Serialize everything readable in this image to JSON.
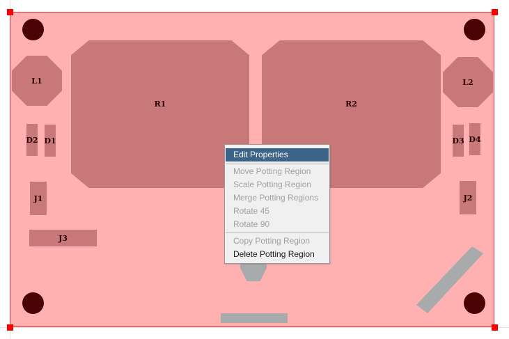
{
  "components": {
    "l1": "L1",
    "l2": "L2",
    "r1": "R1",
    "r2": "R2",
    "d1": "D1",
    "d2": "D2",
    "d3": "D3",
    "d4": "D4",
    "j1": "J1",
    "j2": "J2",
    "j3": "J3"
  },
  "context_menu": {
    "items": [
      {
        "label": "Edit Properties",
        "state": "highlighted"
      },
      {
        "label": "Move Potting Region",
        "state": "disabled"
      },
      {
        "label": "Scale Potting Region",
        "state": "disabled"
      },
      {
        "label": "Merge Potting Regions",
        "state": "disabled"
      },
      {
        "label": "Rotate 45",
        "state": "disabled"
      },
      {
        "label": "Rotate 90",
        "state": "disabled"
      },
      {
        "label": "Copy Potting Region",
        "state": "disabled"
      },
      {
        "label": "Delete Potting Region",
        "state": "enabled"
      }
    ]
  },
  "colors": {
    "board_fill": "#ffb0b0",
    "board_outline": "#e43c3c",
    "component_fill": "#c87878",
    "potting_region": "#a7abab",
    "mounting_hole": "#4a0202",
    "menu_highlight": "#3c6488"
  }
}
